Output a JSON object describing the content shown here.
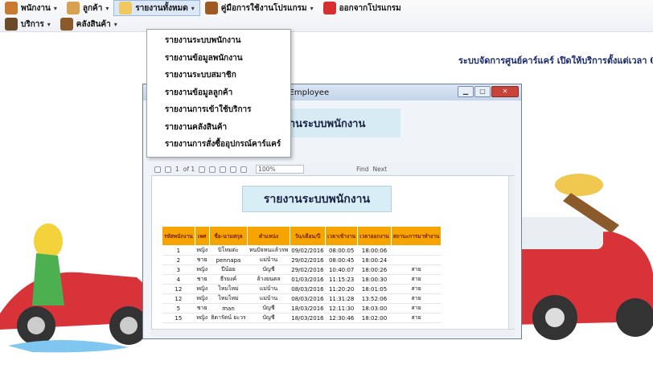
{
  "menubar": {
    "row1": [
      {
        "label": "พนักงาน",
        "icon": "person-icon",
        "color": "#c87a30"
      },
      {
        "label": "ลูกค้า",
        "icon": "customers-icon",
        "color": "#d9a050"
      },
      {
        "label": "รายงานทั้งหมด",
        "icon": "report-pencil-icon",
        "color": "#f0c860",
        "active": true
      },
      {
        "label": "คู่มือการใช้งานโปรแกรม",
        "icon": "manual-book-icon",
        "color": "#a05a20"
      },
      {
        "label": "ออกจากโปรแกรม",
        "icon": "exit-x-icon",
        "color": "#d62f2f"
      }
    ],
    "row2": [
      {
        "label": "บริการ",
        "icon": "service-person-icon",
        "color": "#6b4a2a"
      },
      {
        "label": "คลังสินค้า",
        "icon": "warehouse-box-icon",
        "color": "#8b5a2b"
      }
    ]
  },
  "marquee": "ระบบจัดการศูนย์คาร์แคร์ เปิดให้บริการตั้งแต่เวลา 0",
  "dropdown": [
    "รายงานระบบพนักงาน",
    "รายงานข้อมูลพนักงาน",
    "รายงานระบบสมาชิก",
    "รายงานข้อมูลลูกค้า",
    "รายงานการเข้าใช้บริการ",
    "รายงานคลังสินค้า",
    "รายงานการสั่งซื้ออุปกรณ์คาร์แคร์"
  ],
  "window": {
    "title": "rptfrmEmployee",
    "header": "รายงานระบบพนักงาน",
    "toolbar": {
      "page": "1",
      "of": "of 1",
      "zoom": "100%",
      "find": "Find",
      "next": "Next"
    }
  },
  "report": {
    "title": "รายงานระบบพนักงาน",
    "columns": [
      "รหัสพนักงาน",
      "เพศ",
      "ชื่อ-นามสกุล",
      "ตำแหน่ง",
      "วัน/เดือน/ปี",
      "เวลาเข้างาน",
      "เวลาออกงาน",
      "สถานะการมาทำงาน"
    ],
    "rows": [
      [
        "1",
        "หญิง",
        "ปิโหมต่ะ",
        "หนปัจหนแล้วรพ",
        "09/02/2016",
        "08:00:05",
        "18:00:06",
        ""
      ],
      [
        "2",
        "ชาย",
        "pennapa",
        "แม่บ้าน",
        "29/02/2016",
        "08:00:45",
        "18:00:24",
        ""
      ],
      [
        "3",
        "หญิง",
        "ปีน้อย",
        "บัญชี",
        "29/02/2016",
        "10:40:07",
        "18:00:26",
        "สาย"
      ],
      [
        "4",
        "ชาย",
        "ธีรยงค์",
        "ล้างยนตล",
        "01/03/2016",
        "11:15:23",
        "18:00:30",
        "สาย"
      ],
      [
        "12",
        "หญิง",
        "ไหมไหม่",
        "แม่บ้าน",
        "08/03/2016",
        "11:20:20",
        "18:01:05",
        "สาย"
      ],
      [
        "12",
        "หญิง",
        "ไหมไหม่",
        "แม่บ้าน",
        "08/03/2016",
        "11:31:28",
        "13:52:06",
        "สาย"
      ],
      [
        "5",
        "ชาย",
        "man",
        "บัญชี",
        "18/03/2016",
        "12:11:30",
        "18:03:00",
        "สาย"
      ],
      [
        "15",
        "หญิง",
        "ธิดารัตน์ ยะวร",
        "บัญชี",
        "18/03/2016",
        "12:30:46",
        "18:02:00",
        "สาย"
      ]
    ]
  },
  "colors": {
    "header_orange": "#f6a400",
    "title_bg": "#d8eef6",
    "car_red": "#d9333a"
  }
}
